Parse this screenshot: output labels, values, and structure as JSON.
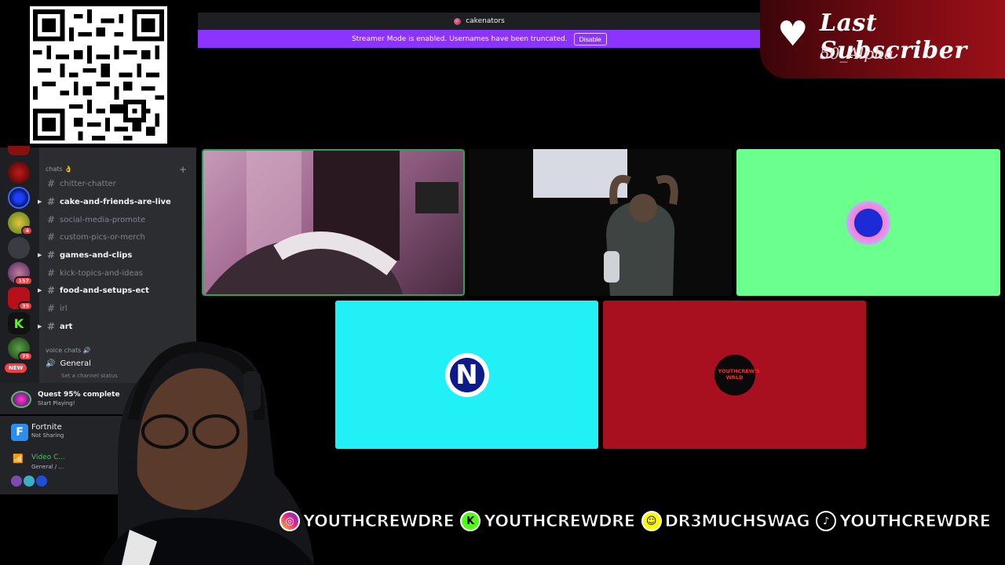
{
  "discord": {
    "server_name": "cakenators",
    "streamer_banner": {
      "text": "Streamer Mode is enabled. Usernames have been truncated.",
      "button": "Disable"
    },
    "categories": {
      "chats": "chats 👌",
      "voice": "voice chats 🔊"
    },
    "channels": [
      {
        "name": "chitter-chatter",
        "unread": false
      },
      {
        "name": "cake-and-friends-are-live",
        "unread": true
      },
      {
        "name": "social-media-promote",
        "unread": false
      },
      {
        "name": "custom-pics-or-merch",
        "unread": false
      },
      {
        "name": "games-and-clips",
        "unread": true
      },
      {
        "name": "kick-topics-and-ideas",
        "unread": false
      },
      {
        "name": "food-and-setups-ect",
        "unread": true
      },
      {
        "name": "irl",
        "unread": false
      },
      {
        "name": "art",
        "unread": true
      }
    ],
    "voice_channel": {
      "name": "General",
      "status": "Set a channel status"
    },
    "server_badges": [
      "4",
      "157",
      "35",
      "75"
    ],
    "new_badge": "NEW",
    "quest": {
      "title": "Quest 95% complete",
      "subtitle": "Start Playing!"
    },
    "game": {
      "name": "Fortnite",
      "status": "Not Sharing",
      "icon_letter": "F"
    },
    "voice_connected": {
      "title": "Video C...",
      "subtitle": "General / ..."
    }
  },
  "last_subscriber": {
    "title": "Last Subscriber",
    "name": "50_Alpha"
  },
  "socials": [
    {
      "platform": "instagram-icon",
      "handle": "YOUTHCREWDRE",
      "color": "#e1306c"
    },
    {
      "platform": "kick-icon",
      "handle": "YOUTHCREWDRE",
      "color": "#53fc18"
    },
    {
      "platform": "snapchat-icon",
      "handle": "DR3MUCHSWAG",
      "color": "#fffc00"
    },
    {
      "platform": "tiktok-icon",
      "handle": "YOUTHCREWDRE",
      "color": "#000000"
    }
  ],
  "tiles": {
    "tile3_color": "#6bff8d",
    "tile4_color": "#22f0f7",
    "tile5_color": "#a8101f",
    "tile5_logo_text": "YOUTHCREW'S WRLD"
  }
}
